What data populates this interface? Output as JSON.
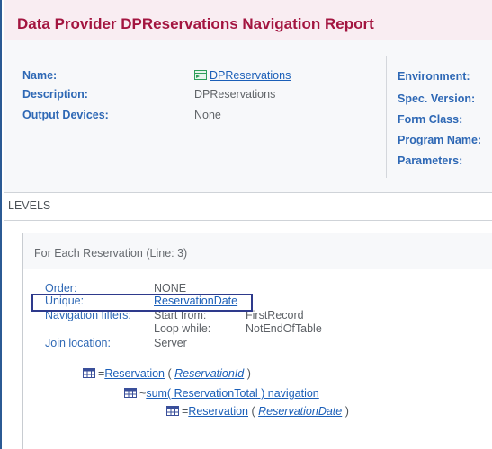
{
  "header": {
    "title": "Data Provider DPReservations Navigation Report"
  },
  "info": {
    "name_label": "Name:",
    "name_value": "DPReservations",
    "description_label": "Description:",
    "description_value": "DPReservations",
    "output_label": "Output Devices:",
    "output_value": "None",
    "environment_label": "Environment:",
    "spec_label": "Spec. Version:",
    "form_label": "Form Class:",
    "program_label": "Program Name:",
    "parameters_label": "Parameters:"
  },
  "levels": {
    "title": "LEVELS"
  },
  "foreach": {
    "title": "For Each Reservation (Line: 3)",
    "order_label": "Order:",
    "order_value": "NONE",
    "unique_label": "Unique:",
    "unique_value": "ReservationDate",
    "filters_label": "Navigation filters:",
    "start_from_label": "Start from:",
    "start_from_value": "FirstRecord",
    "loop_while_label": "Loop while:",
    "loop_while_value": "NotEndOfTable",
    "join_label": "Join location:",
    "join_value": "Server"
  },
  "tree": [
    {
      "prefix": "=",
      "name": "Reservation",
      "open": " ( ",
      "attr": "ReservationId",
      "close": " )"
    },
    {
      "prefix": "~",
      "name": "sum( ReservationTotal ) navigation"
    },
    {
      "prefix": "=",
      "name": "Reservation",
      "open": " ( ",
      "attr": "ReservationDate",
      "close": " )"
    }
  ],
  "colors": {
    "title": "#a31540",
    "label": "#2e68b5",
    "link": "#1b5fb8",
    "highlight": "#2e3a8c",
    "icon": "#2e9e5a"
  }
}
